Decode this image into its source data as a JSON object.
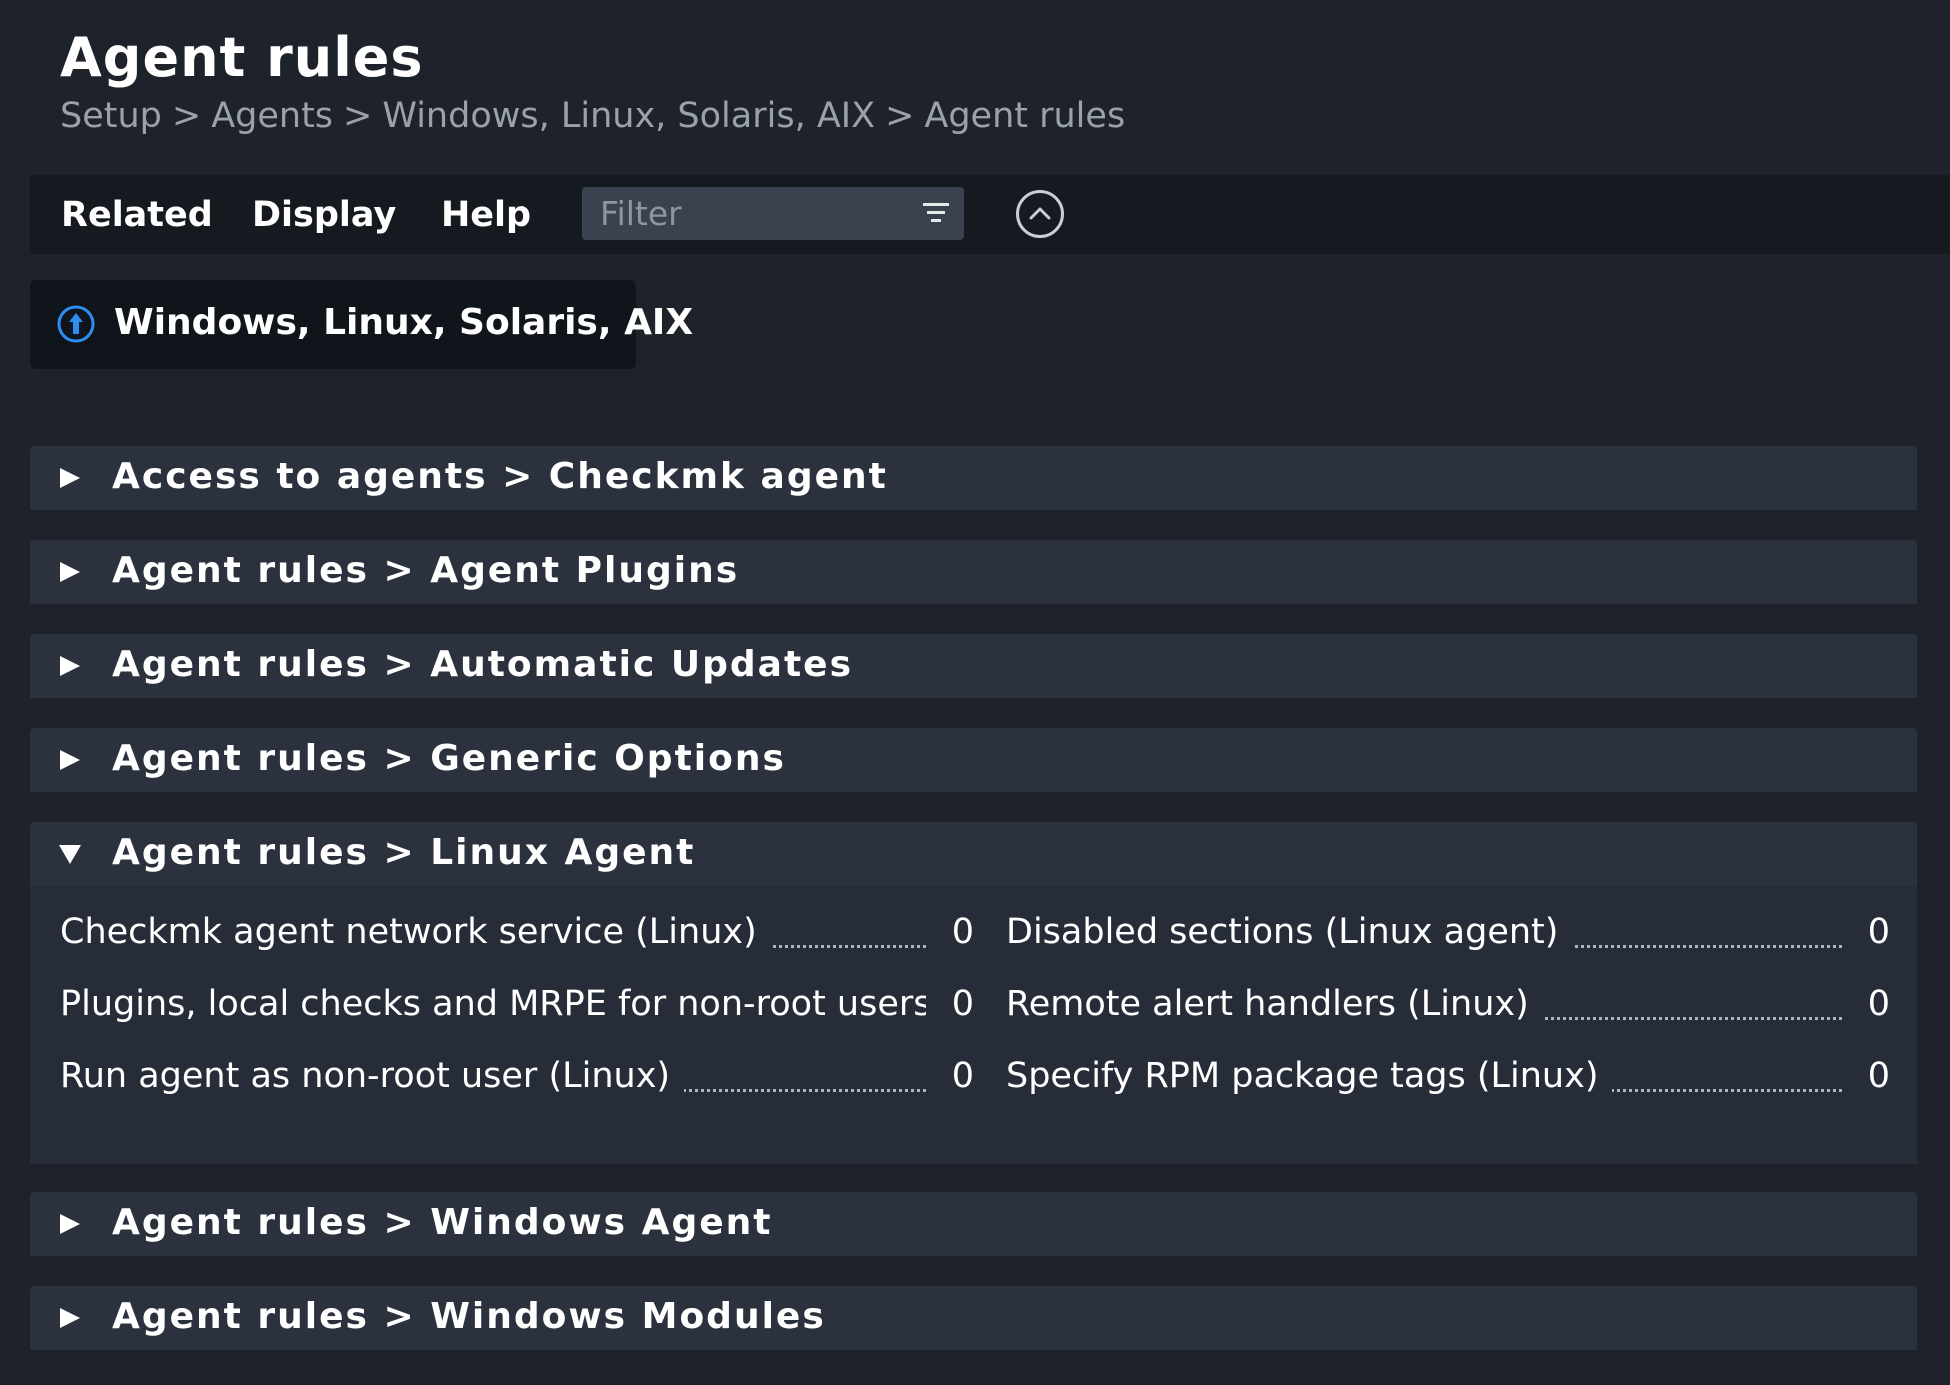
{
  "page": {
    "title": "Agent rules",
    "breadcrumb": [
      "Setup",
      "Agents",
      "Windows, Linux, Solaris, AIX",
      "Agent rules"
    ],
    "breadcrumb_separator": ">"
  },
  "menubar": {
    "items": [
      "Related",
      "Display",
      "Help"
    ],
    "filter_placeholder": "Filter"
  },
  "back_link": {
    "label": "Windows, Linux, Solaris, AIX",
    "icon": "circle-arrow-up-icon"
  },
  "colors": {
    "background": "#1e232b",
    "menubar": "#151a21",
    "section_header": "#2b323e",
    "accent_blue": "#2f8cf0"
  },
  "sections": [
    {
      "title": "Access to agents > Checkmk agent",
      "expanded": false
    },
    {
      "title": "Agent rules > Agent Plugins",
      "expanded": false
    },
    {
      "title": "Agent rules > Automatic Updates",
      "expanded": false
    },
    {
      "title": "Agent rules > Generic Options",
      "expanded": false
    },
    {
      "title": "Agent rules > Linux Agent",
      "expanded": true,
      "rules": [
        {
          "name": "Checkmk agent network service (Linux)",
          "count": "0"
        },
        {
          "name": "Disabled sections (Linux agent)",
          "count": "0"
        },
        {
          "name": "Plugins, local checks and MRPE for non-root users",
          "count": "0"
        },
        {
          "name": "Remote alert handlers (Linux)",
          "count": "0"
        },
        {
          "name": "Run agent as non-root user (Linux)",
          "count": "0"
        },
        {
          "name": "Specify RPM package tags (Linux)",
          "count": "0"
        }
      ]
    },
    {
      "title": "Agent rules > Windows Agent",
      "expanded": false
    },
    {
      "title": "Agent rules > Windows Modules",
      "expanded": false
    }
  ]
}
